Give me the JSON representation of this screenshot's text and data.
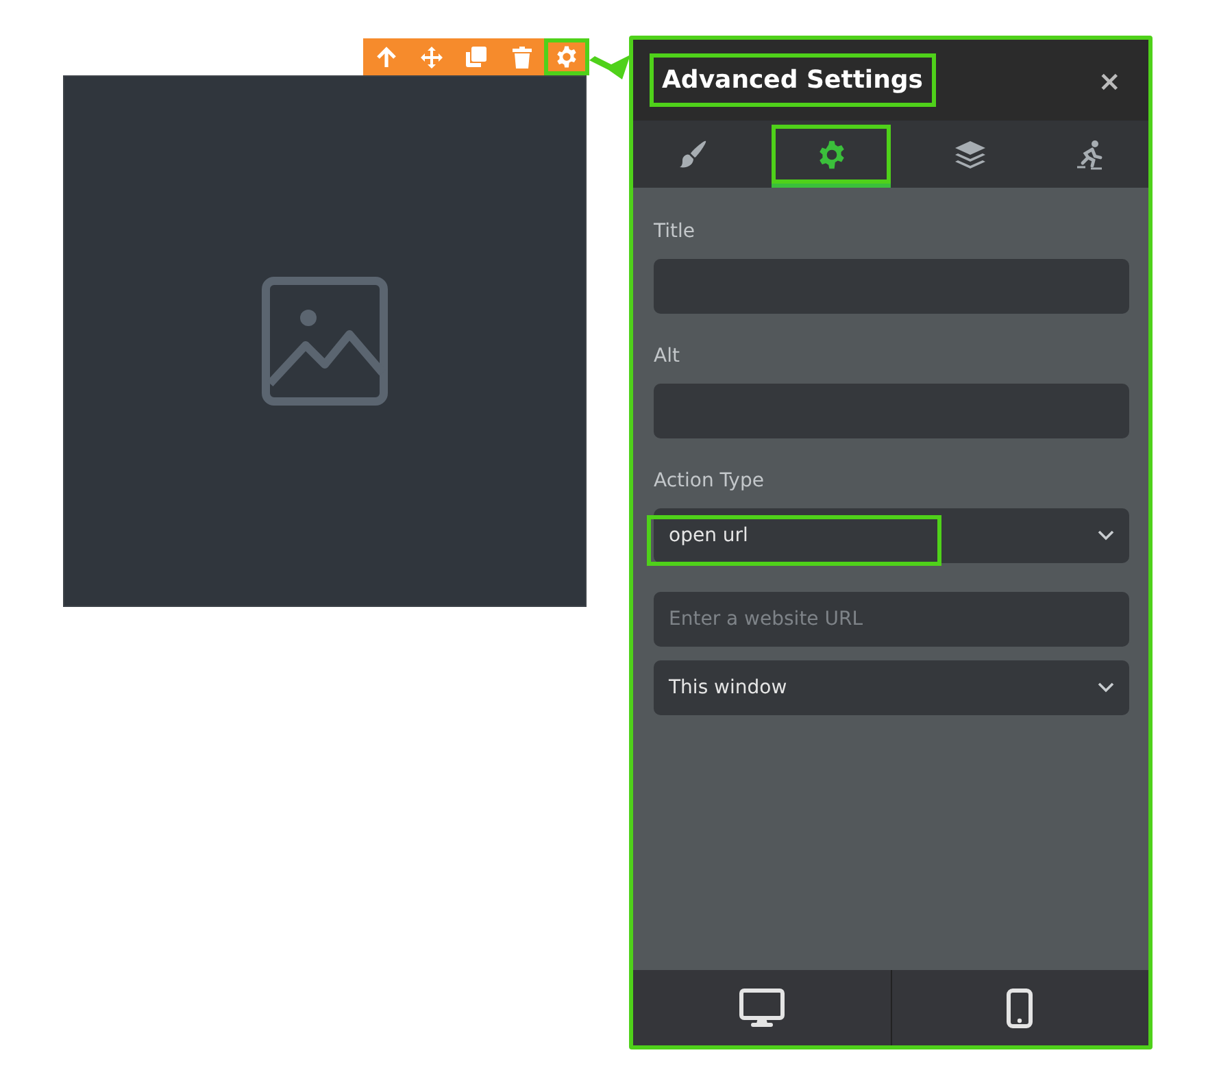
{
  "toolbar": {
    "buttons": [
      {
        "kind": "up",
        "highlighted": false
      },
      {
        "kind": "move",
        "highlighted": false
      },
      {
        "kind": "duplicate",
        "highlighted": false
      },
      {
        "kind": "delete",
        "highlighted": false
      },
      {
        "kind": "settings",
        "highlighted": true
      }
    ]
  },
  "panel": {
    "title": "Advanced Settings",
    "title_highlighted": true,
    "close": "×",
    "tabs": [
      {
        "kind": "brush",
        "selected": false,
        "highlighted": false
      },
      {
        "kind": "gear",
        "selected": true,
        "highlighted": true
      },
      {
        "kind": "layers",
        "selected": false,
        "highlighted": false
      },
      {
        "kind": "motion",
        "selected": false,
        "highlighted": false
      }
    ],
    "fields": [
      {
        "kind": "text",
        "label": "Title"
      },
      {
        "kind": "text",
        "label": "Alt"
      },
      {
        "kind": "select",
        "label": "Action Type",
        "value": "open url",
        "highlighted": true
      },
      {
        "kind": "text",
        "placeholder": "Enter a website URL"
      },
      {
        "kind": "select",
        "value": "This window",
        "highlighted": false
      }
    ],
    "devices": [
      {
        "kind": "desktop"
      },
      {
        "kind": "mobile"
      }
    ]
  }
}
